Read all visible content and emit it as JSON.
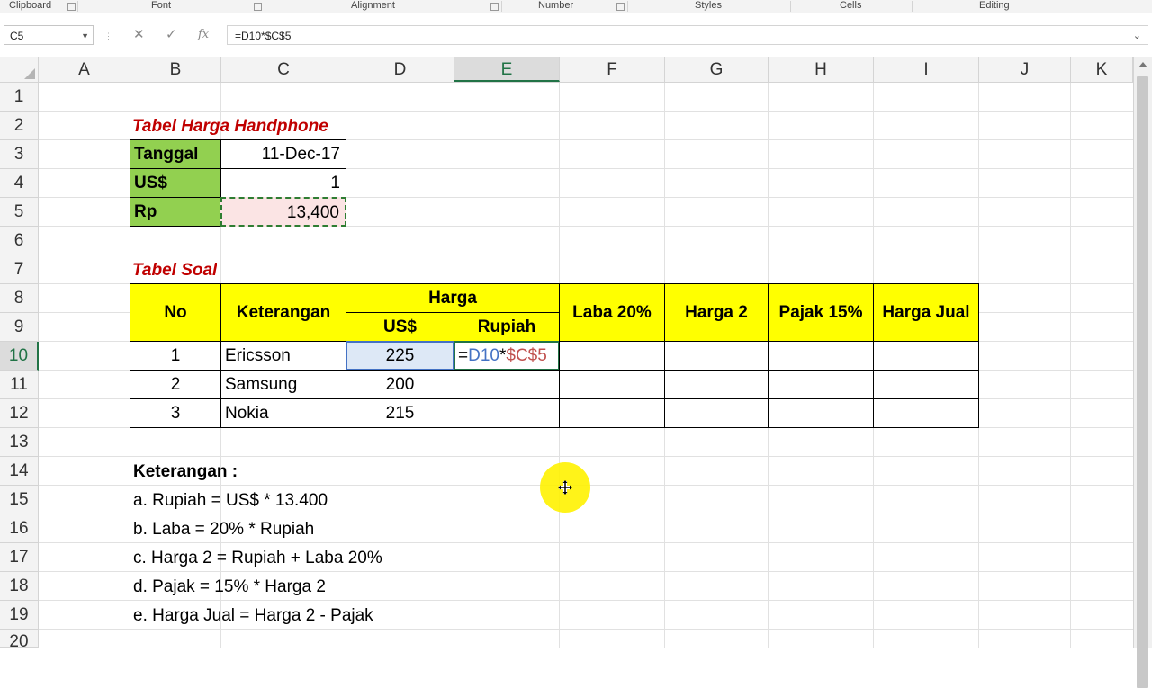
{
  "ribbon": {
    "groups": [
      "Clipboard",
      "Font",
      "Alignment",
      "Number",
      "Styles",
      "Cells",
      "Editing"
    ]
  },
  "formula_bar": {
    "name_box": "C5",
    "cancel_icon": "x-icon",
    "enter_icon": "check-icon",
    "fx_label": "fx",
    "formula": "=D10*$C$5"
  },
  "columns": [
    "A",
    "B",
    "C",
    "D",
    "E",
    "F",
    "G",
    "H",
    "I",
    "J",
    "K"
  ],
  "rows": [
    "1",
    "2",
    "3",
    "4",
    "5",
    "6",
    "7",
    "8",
    "9",
    "10",
    "11",
    "12",
    "13",
    "14",
    "15",
    "16",
    "17",
    "18",
    "19",
    "20"
  ],
  "selected_column": "E",
  "selected_row": "10",
  "table1": {
    "title": "Tabel Harga Handphone",
    "rows": [
      {
        "label": "Tanggal",
        "value": "11-Dec-17"
      },
      {
        "label": "US$",
        "value": "1"
      },
      {
        "label": "Rp",
        "value": "13,400"
      }
    ]
  },
  "table2": {
    "title": "Tabel Soal",
    "headers": {
      "no": "No",
      "keterangan": "Keterangan",
      "harga": "Harga",
      "usd": "US$",
      "rupiah": "Rupiah",
      "laba": "Laba 20%",
      "harga2": "Harga 2",
      "pajak": "Pajak 15%",
      "harga_jual": "Harga Jual"
    },
    "rows": [
      {
        "no": "1",
        "name": "Ericsson",
        "usd": "225"
      },
      {
        "no": "2",
        "name": "Samsung",
        "usd": "200"
      },
      {
        "no": "3",
        "name": "Nokia",
        "usd": "215"
      }
    ],
    "edit_formula": {
      "eq": "=",
      "ref1": "D10",
      "op": "*",
      "ref2": "$C$5"
    }
  },
  "notes": {
    "title": "Keterangan :",
    "items": [
      "a. Rupiah = US$ * 13.400",
      "b. Laba = 20% * Rupiah",
      "c. Harga 2 = Rupiah + Laba 20%",
      "d. Pajak = 15% * Harga 2",
      "e. Harga Jual = Harga 2 - Pajak"
    ]
  },
  "colors": {
    "green_fill": "#92d050",
    "yellow_fill": "#ffff00",
    "title_red": "#c00000",
    "excel_green": "#217346"
  }
}
